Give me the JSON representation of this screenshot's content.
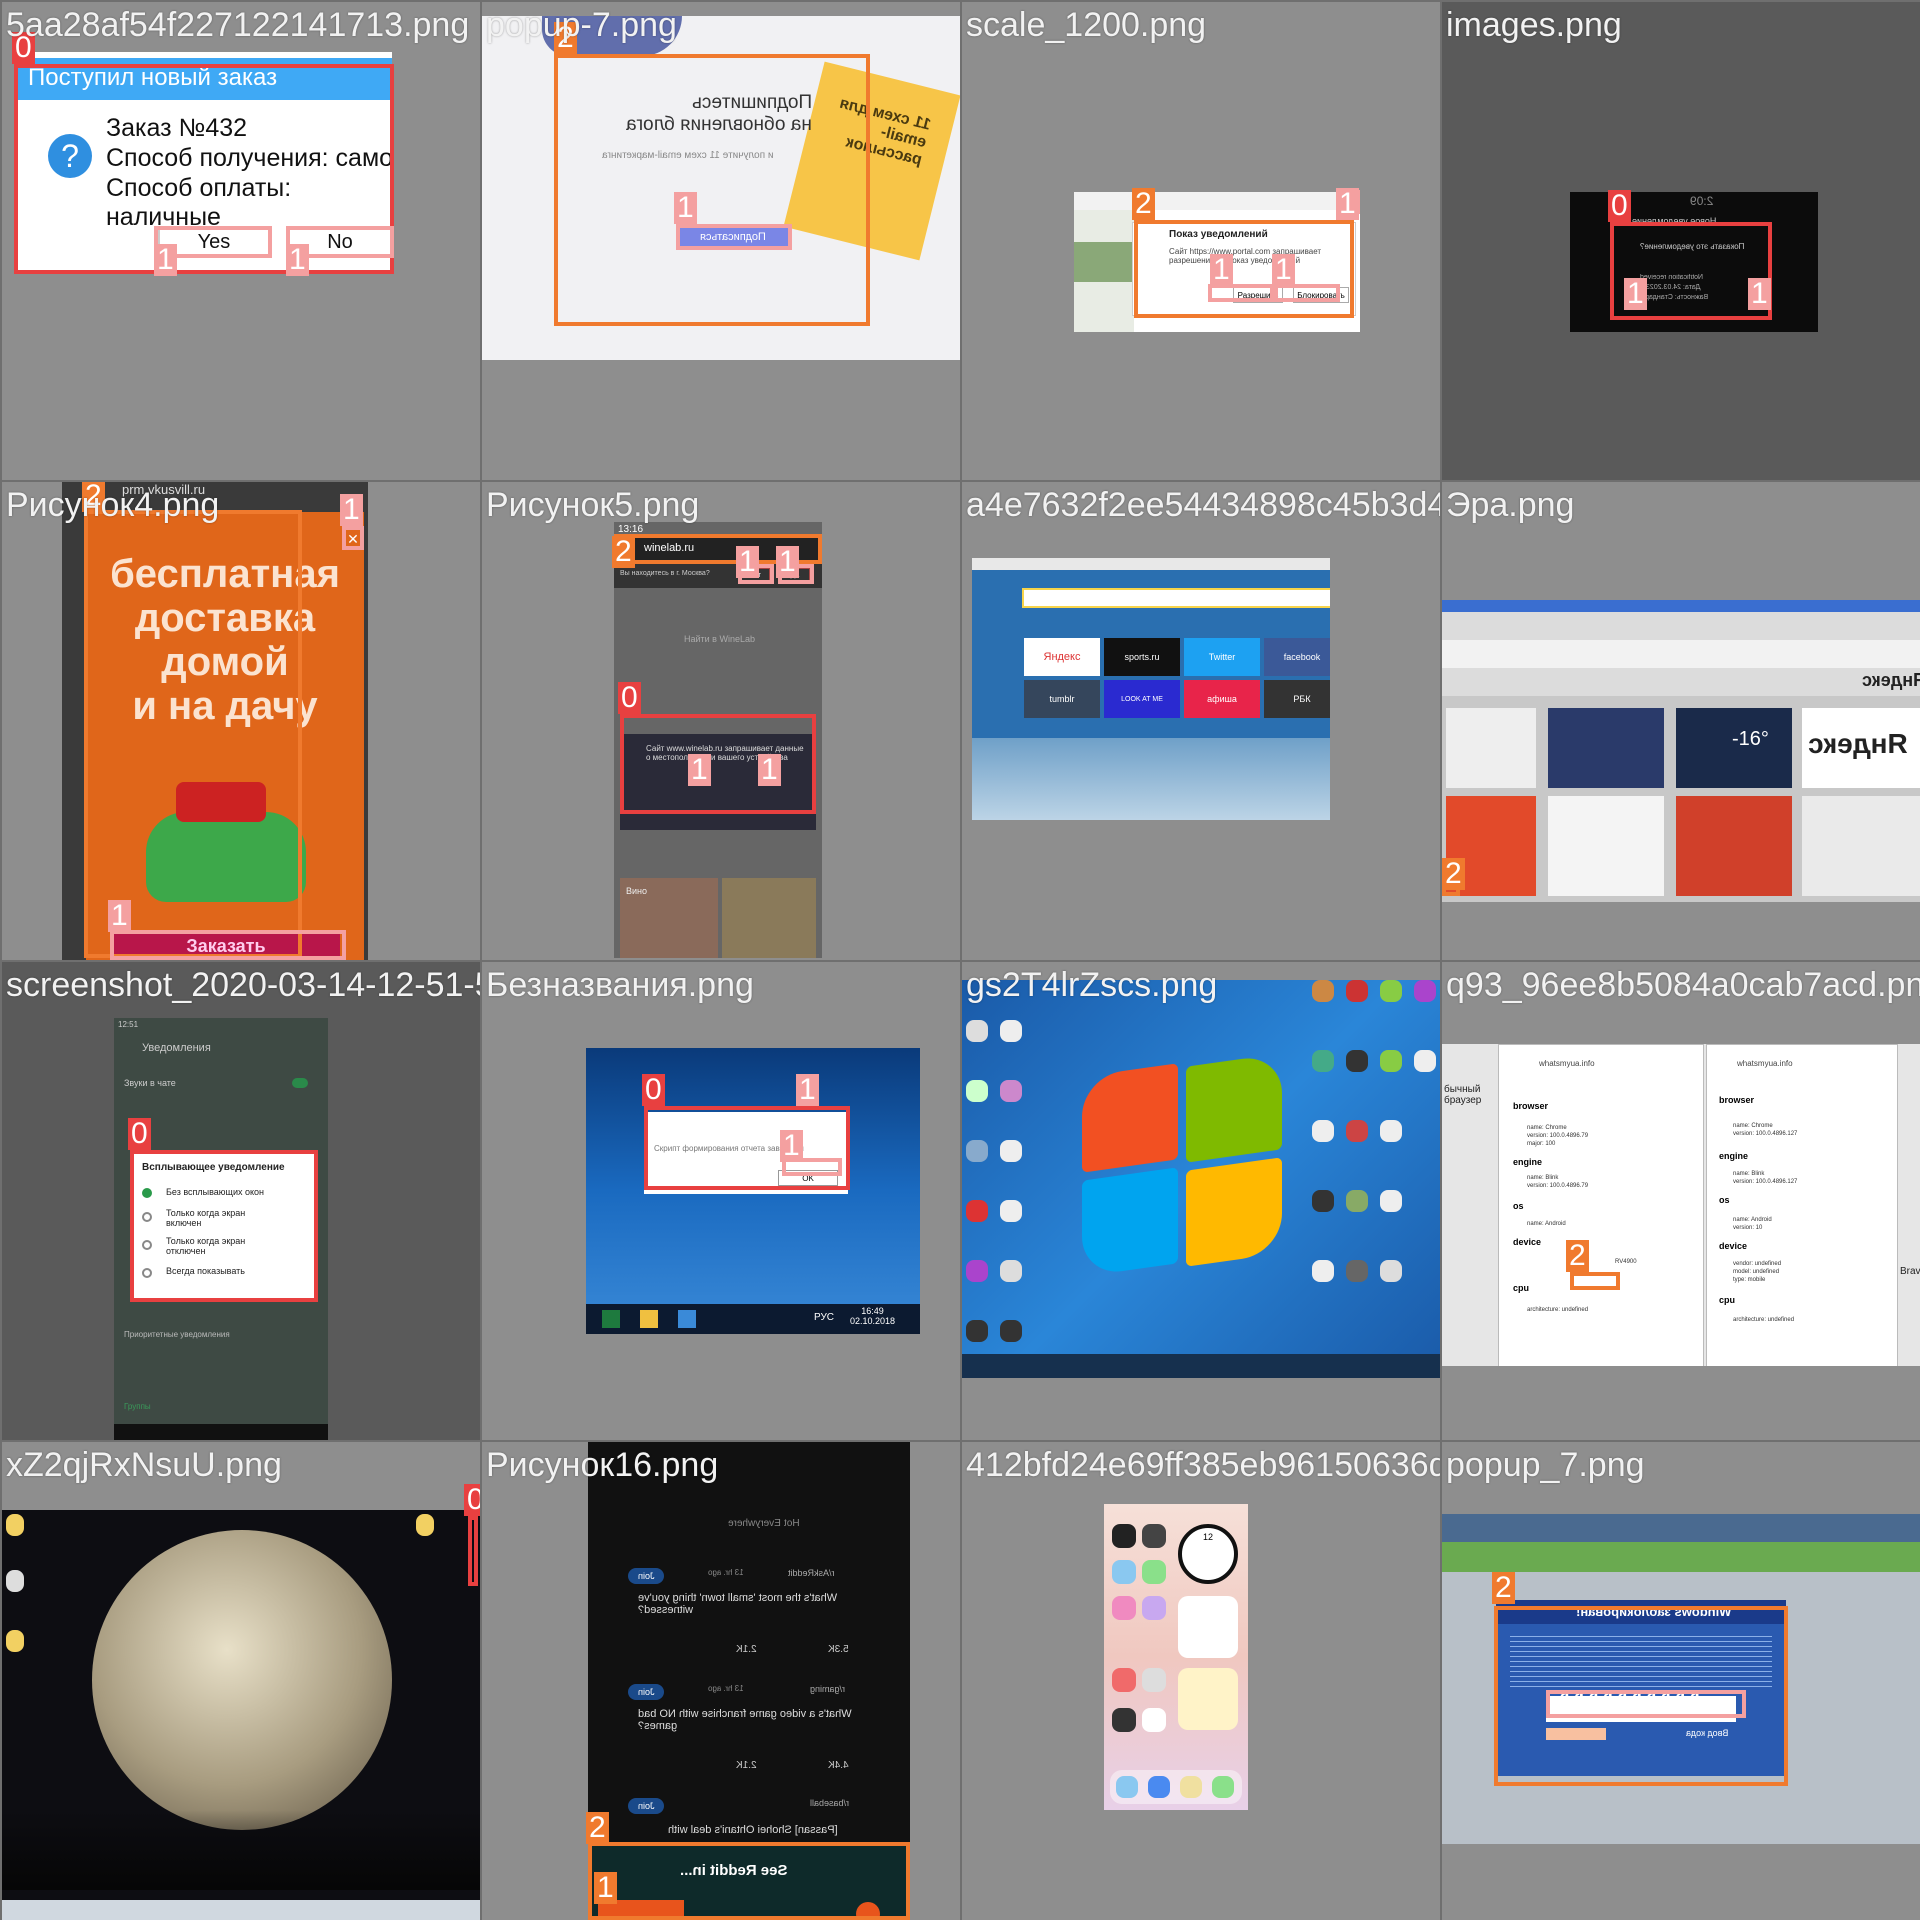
{
  "tiles": [
    {
      "filename": "5aa28af54f227122141713.png",
      "dialog_title": "Поступил новый заказ",
      "line1": "Заказ №432",
      "line2": "Способ получения: самовывоз",
      "line3": "Способ оплаты: наличные",
      "yes": "Yes",
      "no": "No",
      "labels": [
        "0",
        "1",
        "1"
      ]
    },
    {
      "filename": "popup-7.png",
      "title_line1": "Подпишитесь",
      "title_line2": "на обновления блога",
      "sub": "и получите 11 схем email-маркетинга",
      "button": "Подписаться",
      "card_text": "11 схем для email-рассылок",
      "labels": [
        "2",
        "1"
      ]
    },
    {
      "filename": "scale_1200.png",
      "popup_title": "Показ уведомлений",
      "popup_text": "Сайт https://www.portal.com запрашивает разрешение на показ уведомлений",
      "allow": "Разрешить",
      "block": "Блокировать",
      "labels": [
        "2",
        "1",
        "1",
        "1"
      ]
    },
    {
      "filename": "images.png",
      "time": "2:09",
      "title": "Новое уведомление",
      "text1": "Показать это уведомление?",
      "text2": "Notification received",
      "text3": "Дата: 24.03.2023",
      "text4": "Важность: Стандарт",
      "labels": [
        "0",
        "1",
        "1"
      ]
    },
    {
      "filename": "Рисунок4.png",
      "url": "prm.vkusvill.ru",
      "headline1": "бесплатная",
      "headline2": "доставка",
      "headline3": "домой",
      "headline4": "и на дачу",
      "order_button": "Заказать",
      "close": "✕",
      "labels": [
        "2",
        "1",
        "1"
      ]
    },
    {
      "filename": "Рисунок5.png",
      "time": "13:16",
      "url": "winelab.ru",
      "city_q": "Вы находитесь в г. Москва?",
      "no": "Нет",
      "yes": "Да",
      "search": "Найти в WineLab",
      "geo_text": "Сайт www.winelab.ru запрашивает данные о местоположении вашего устройства",
      "wine": "Вино",
      "labels": [
        "2",
        "1",
        "1",
        "0",
        "1",
        "1"
      ]
    },
    {
      "filename": "a4e7632f2ee54434898c45b3d4bea43a8.png",
      "tiles": [
        "Яндекс",
        "sports.ru",
        "Twitter",
        "facebook",
        "tumblr",
        "LOOK AT ME",
        "афиша",
        "РБК"
      ],
      "labels": []
    },
    {
      "filename": "Эра.png",
      "title": "Яндекс",
      "weather": "-16°",
      "labels": [
        "2"
      ]
    },
    {
      "filename": "screenshot_2020-03-14-12-51-50-706_com.png",
      "time": "12:51",
      "header": "Уведомления",
      "sound_title": "Звуки в чате",
      "popup_title": "Всплывающее уведомление",
      "options": [
        "Без всплывающих окон",
        "Только когда экран включен",
        "Только когда экран отключен",
        "Всегда показывать"
      ],
      "priority": "Приоритетные уведомления",
      "groups": "Группы",
      "labels": [
        "0"
      ]
    },
    {
      "filename": "Безназвания.png",
      "dialog_text": "Скрипт формирования отчета завершен",
      "ok": "OK",
      "lang": "РУС",
      "clock_time": "16:49",
      "clock_date": "02.10.2018",
      "labels": [
        "0",
        "1",
        "1"
      ]
    },
    {
      "filename": "gs2T4lrZscs.png",
      "labels": []
    },
    {
      "filename": "q93_96ee8b5084a0cab7acd.png",
      "url": "whatsmyua.info",
      "browser_h": "browser",
      "engine_h": "engine",
      "os_h": "os",
      "device_h": "device",
      "cpu_h": "cpu",
      "left_browser_name": "name: Chrome",
      "left_browser_ver": "version: 100.0.4896.79",
      "left_major": "major: 100",
      "left_engine_name": "name: Blink",
      "left_engine_ver": "version: 100.0.4896.79",
      "left_os_name": "name: Android",
      "left_device_model": "RV4900",
      "left_cpu": "architecture: undefined",
      "right_browser_ver": "version: 100.0.4896.127",
      "right_engine_ver": "version: 100.0.4896.127",
      "right_os_ver": "version: 10",
      "right_vendor": "vendor: undefined",
      "right_model": "model: undefined",
      "right_type": "type: mobile",
      "right_cpu": "architecture: undefined",
      "side_left": "бычный браузер",
      "side_right": "Brav",
      "labels": [
        "2"
      ]
    },
    {
      "filename": "xZ2qjRxNsuU.png",
      "labels": [
        "0"
      ]
    },
    {
      "filename": "Рисунок16.png",
      "tabs": [
        "Hot",
        "Everywhere"
      ],
      "post1_sub": "r/AskReddit",
      "post1_time": "13 hr. ago",
      "post1_title": "What's the most 'small town' thing you've witnessed?",
      "post1_votes": "5.3K",
      "post1_comments": "2.1K",
      "post2_sub": "r/gaming",
      "post2_time": "13 hr. ago",
      "post2_title": "What's a video game franchise with NO bad games?",
      "post2_votes": "4.4K",
      "post2_comments": "2.1K",
      "post3_sub": "r/baseball",
      "post3_title": "[Passan] Shohei Ohtani's deal with",
      "join": "Join",
      "banner": "See Reddit in...",
      "labels": [
        "2",
        "1"
      ]
    },
    {
      "filename": "412bfd24e69ff385eb96150636d9ae9.png",
      "clock_num": "12",
      "labels": []
    },
    {
      "filename": "popup_7.png",
      "banner_title": "Windows заблокирован!",
      "input_label": "Ввод кода",
      "labels": [
        "2",
        "1",
        "1",
        "1",
        "1",
        "1",
        "1",
        "1",
        "1",
        "1",
        "1"
      ]
    }
  ]
}
